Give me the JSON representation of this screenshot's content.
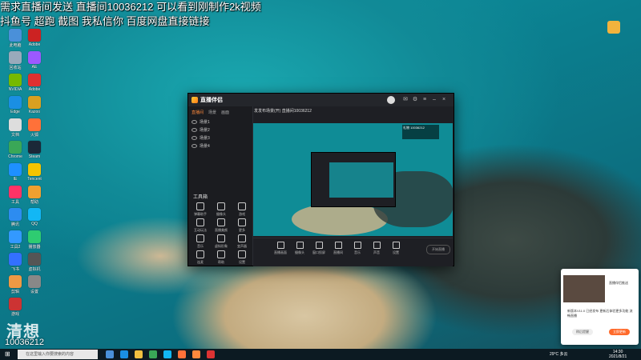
{
  "overlay": {
    "line1": "需求直播间发送   直播间10036212 可以看到刚制作2k视频",
    "line2": "抖鱼号 超跑 截图 我私信你 百度网盘直接链接"
  },
  "desktop_icons": [
    {
      "label": "此电脑",
      "color": "#4a90d9"
    },
    {
      "label": "Adobe",
      "color": "#cc2222"
    },
    {
      "label": "回收站",
      "color": "#9ab"
    },
    {
      "label": "AE",
      "color": "#9b59ff"
    },
    {
      "label": "NVIDIA",
      "color": "#76b900"
    },
    {
      "label": "Adobe",
      "color": "#e03030"
    },
    {
      "label": "Edge",
      "color": "#1a8fe3"
    },
    {
      "label": "Kazoo",
      "color": "#d9a020"
    },
    {
      "label": "文档",
      "color": "#ddd"
    },
    {
      "label": "火狐",
      "color": "#ff7139"
    },
    {
      "label": "Chrome",
      "color": "#3aa757"
    },
    {
      "label": "Steam",
      "color": "#1b2838"
    },
    {
      "label": "IE",
      "color": "#1e90ff"
    },
    {
      "label": "Tencent",
      "color": "#f5c400"
    },
    {
      "label": "工具",
      "color": "#ff3366"
    },
    {
      "label": "帮助",
      "color": "#f0a030"
    },
    {
      "label": "腾讯",
      "color": "#2d8cf0"
    },
    {
      "label": "QQ",
      "color": "#12b7f5"
    },
    {
      "label": "工具2",
      "color": "#3399ff"
    },
    {
      "label": "播放器",
      "color": "#2ecc71"
    },
    {
      "label": "飞书",
      "color": "#3370ff"
    },
    {
      "label": "虚拟机",
      "color": "#555"
    },
    {
      "label": "剪辑",
      "color": "#e94"
    },
    {
      "label": "设置",
      "color": "#888"
    },
    {
      "label": "游戏",
      "color": "#c33"
    }
  ],
  "id_badge": {
    "big": "清想",
    "number": "10036212"
  },
  "app": {
    "title": "直播伴侣",
    "tabs": [
      "直播间",
      "场景",
      "画面"
    ],
    "scenes": [
      "场景1",
      "场景2",
      "场景3",
      "场景4"
    ],
    "tools_title": "工具箱",
    "tools": [
      "弹幕助手",
      "摄像头",
      "游戏",
      "互动玩法",
      "直播美颜",
      "更多",
      "音乐",
      "虚拟形象",
      "变声器",
      "连麦",
      "帮助",
      "设置"
    ],
    "stream_title": "发发布场景(开) 直播间10036212",
    "live_tag": "礼物 10036212",
    "bottom": [
      "直播画面",
      "摄像头",
      "窗口投屏",
      "直播间",
      "音乐",
      "声音",
      "设置"
    ],
    "start_live": "开始直播"
  },
  "popup": {
    "title": "直播伴侣推送",
    "body": "新版本V11.0 已经发布 更新后体验更多功能 流畅直播",
    "btn_later": "稍后提醒",
    "btn_update": "立即更新"
  },
  "taskbar": {
    "search_placeholder": "在这里输入你要搜索的内容",
    "weather": "29°C 多云",
    "time": "14:30",
    "date": "2021/8/21"
  }
}
